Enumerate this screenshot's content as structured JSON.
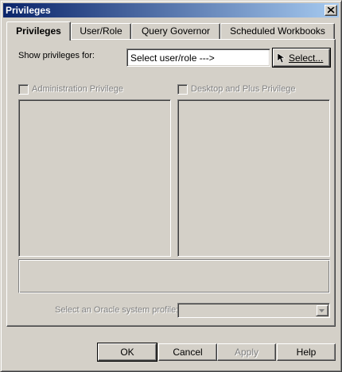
{
  "window": {
    "title": "Privileges"
  },
  "tabs": [
    {
      "label": "Privileges",
      "active": true
    },
    {
      "label": "User/Role",
      "active": false
    },
    {
      "label": "Query Governor",
      "active": false
    },
    {
      "label": "Scheduled Workbooks",
      "active": false
    }
  ],
  "privileges_panel": {
    "show_label": "Show privileges for:",
    "user_field_value": "Select user/role --->",
    "select_button_label": "Select...",
    "admin_privilege_label": "Administration Privilege",
    "desktop_privilege_label": "Desktop and Plus Privilege",
    "profile_label": "Select an Oracle system profile:",
    "profile_value": ""
  },
  "buttons": {
    "ok": "OK",
    "cancel": "Cancel",
    "apply": "Apply",
    "help": "Help"
  },
  "icons": {
    "close": "close-icon",
    "select_cursor": "cursor-arrow-icon",
    "dropdown": "chevron-down-icon"
  }
}
